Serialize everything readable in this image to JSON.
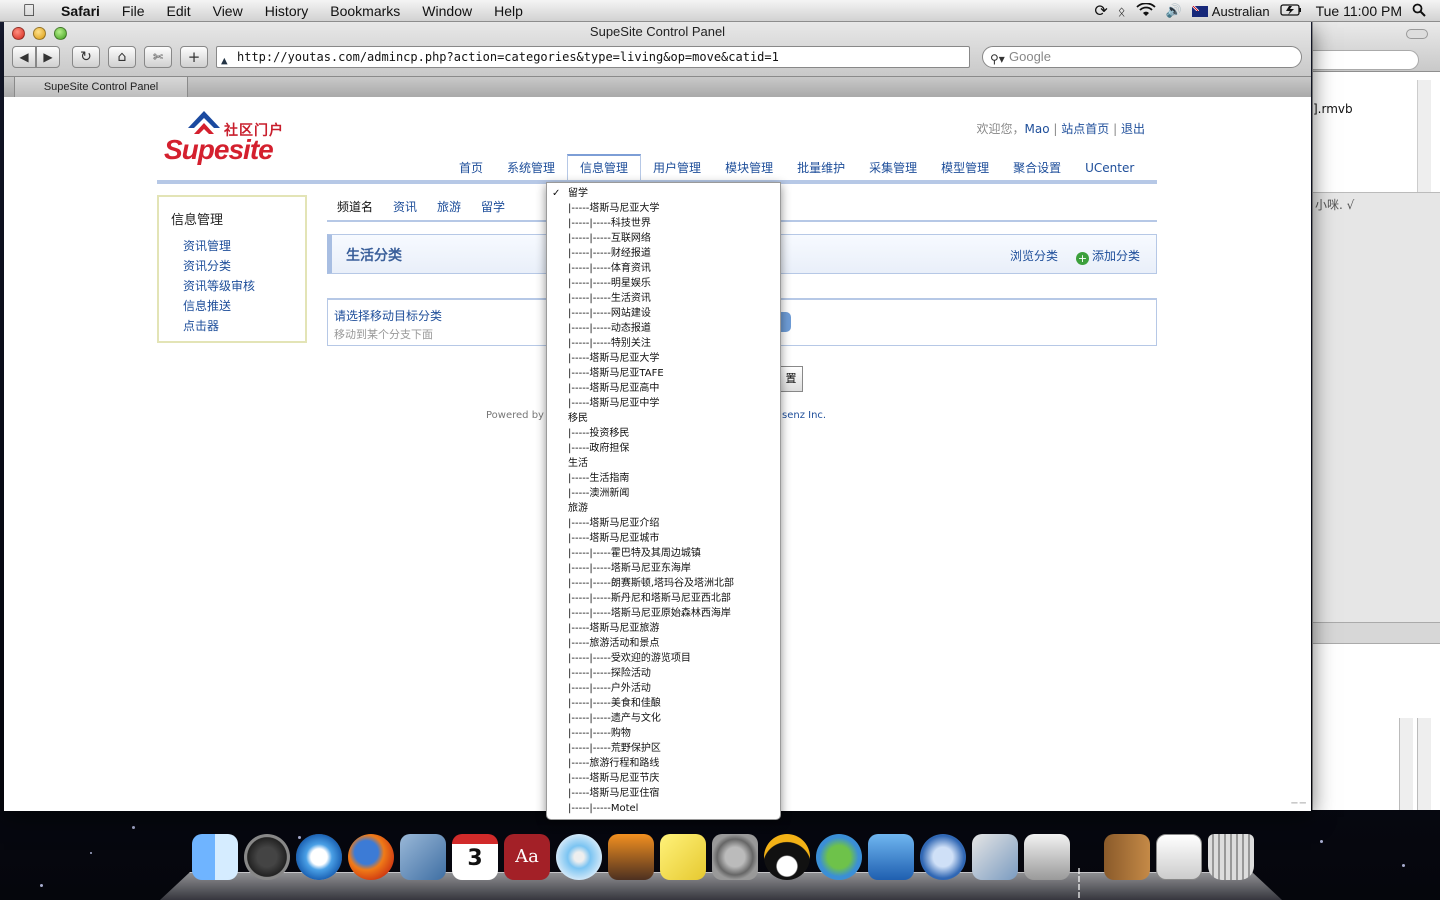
{
  "menubar": {
    "app": "Safari",
    "items": [
      "File",
      "Edit",
      "View",
      "History",
      "Bookmarks",
      "Window",
      "Help"
    ],
    "input_source": "Australian",
    "clock": "Tue 11:00 PM"
  },
  "background_window": {
    "text1": "].rmvb",
    "text2": "小咪. √"
  },
  "window": {
    "title": "SupeSite Control Panel",
    "url": "http://youtas.com/admincp.php?action=categories&type=living&op=move&catid=1",
    "search_placeholder": "Google",
    "tab_label": "SupeSite Control Panel"
  },
  "page": {
    "logo_cn": "社区门户",
    "logo_en_a": "Supe",
    "logo_en_b": "site",
    "welcome": "欢迎您，",
    "user": "Mao",
    "home_link": "站点首页",
    "logout": "退出",
    "nav": [
      "首页",
      "系统管理",
      "信息管理",
      "用户管理",
      "模块管理",
      "批量维护",
      "采集管理",
      "模型管理",
      "聚合设置",
      "UCenter"
    ],
    "sidebar_title": "信息管理",
    "sidebar_items": [
      "资讯管理",
      "资讯分类",
      "资讯等级审核",
      "信息推送",
      "点击器"
    ],
    "channel_tabs": [
      "频道名",
      "资讯",
      "旅游",
      "留学"
    ],
    "panel_title": "生活分类",
    "browse_link": "浏览分类",
    "add_link": "添加分类",
    "form_label": "请选择移动目标分类",
    "form_sub": "移动到某个分支下面",
    "reset_label": "置",
    "powered_by": "Powered by",
    "powered_tail": "senz Inc."
  },
  "dropdown": {
    "selected": "留学",
    "options": [
      "留学",
      "|-----塔斯马尼亚大学",
      "|-----|-----科技世界",
      "|-----|-----互联网络",
      "|-----|-----财经报道",
      "|-----|-----体育资讯",
      "|-----|-----明星娱乐",
      "|-----|-----生活资讯",
      "|-----|-----网站建设",
      "|-----|-----动态报道",
      "|-----|-----特别关注",
      "|-----塔斯马尼亚大学",
      "|-----塔斯马尼亚TAFE",
      "|-----塔斯马尼亚高中",
      "|-----塔斯马尼亚中学",
      "移民",
      "|-----投资移民",
      "|-----政府担保",
      "生活",
      "|-----生活指南",
      "|-----澳洲新闻",
      "旅游",
      "|-----塔斯马尼亚介绍",
      "|-----塔斯马尼亚城市",
      "|-----|-----霍巴特及其周边城镇",
      "|-----|-----塔斯马尼亚东海岸",
      "|-----|-----朗赛斯顿,塔玛谷及塔洲北部",
      "|-----|-----斯丹尼和塔斯马尼亚西北部",
      "|-----|-----塔斯马尼亚原始森林西海岸",
      "|-----塔斯马尼亚旅游",
      "|-----旅游活动和景点",
      "|-----|-----受欢迎的游览项目",
      "|-----|-----探险活动",
      "|-----|-----户外活动",
      "|-----|-----美食和佳酿",
      "|-----|-----遗产与文化",
      "|-----|-----购物",
      "|-----|-----荒野保护区",
      "|-----旅游行程和路线",
      "|-----塔斯马尼亚节庆",
      "|-----塔斯马尼亚住宿",
      "|-----|-----Motel"
    ]
  },
  "dock": {
    "icons": [
      "finder-icon",
      "dashboard-icon",
      "safari-icon",
      "firefox-icon",
      "mail-icon",
      "ical-icon",
      "dictionary-icon",
      "itunes-icon",
      "photobooth-icon",
      "stickies-icon",
      "system-preferences-icon",
      "qq-icon",
      "msn-icon",
      "word-icon",
      "quicktime-icon",
      "preview-icon",
      "grab-icon",
      "address-book-icon",
      "document-icon",
      "trash-icon"
    ],
    "calendar_day": "3",
    "calendar_month": "NOV",
    "dictionary_glyph": "Aa"
  },
  "colors": {
    "link": "#1e4e9a",
    "brand_red": "#d4202e",
    "nav_line": "#b6c8e6"
  }
}
